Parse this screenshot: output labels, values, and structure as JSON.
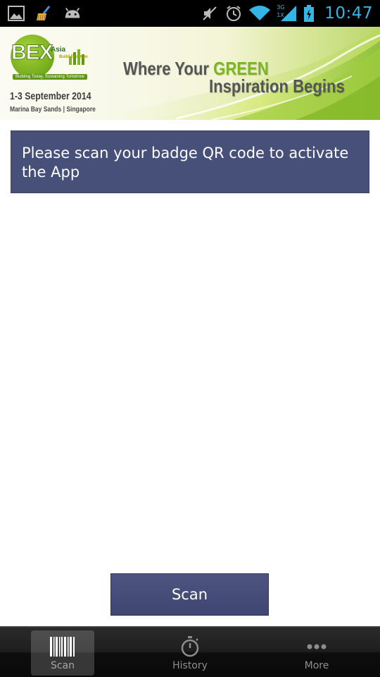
{
  "status_bar": {
    "time": "10:47",
    "network_label_top": "3G",
    "network_label_bottom": "1X",
    "icons": [
      "gallery-icon",
      "broom-icon",
      "android-icon",
      "mute-icon",
      "alarm-icon",
      "wifi-icon",
      "signal-icon",
      "battery-charging-icon"
    ]
  },
  "banner": {
    "logo_text": "BEX",
    "logo_asia": "Asia",
    "logo_sub": "Build Eco Xpo",
    "logo_tagline": "Building Today, Sustaining Tomorrow",
    "date": "1-3 September 2014",
    "venue": "Marina Bay Sands | Singapore",
    "headline_part1": "Where Your ",
    "headline_green": "GREEN",
    "headline_part2": "Inspiration Begins"
  },
  "notice": {
    "text": "Please scan your badge QR code to activate the App"
  },
  "scan_button": {
    "label": "Scan"
  },
  "tabs": [
    {
      "label": "Scan",
      "icon": "barcode-icon",
      "active": true
    },
    {
      "label": "History",
      "icon": "stopwatch-icon",
      "active": false
    },
    {
      "label": "More",
      "icon": "more-dots-icon",
      "active": false
    }
  ],
  "colors": {
    "status_clock": "#33b5e5",
    "panel": "#475079",
    "brand_green": "#7fb524"
  }
}
